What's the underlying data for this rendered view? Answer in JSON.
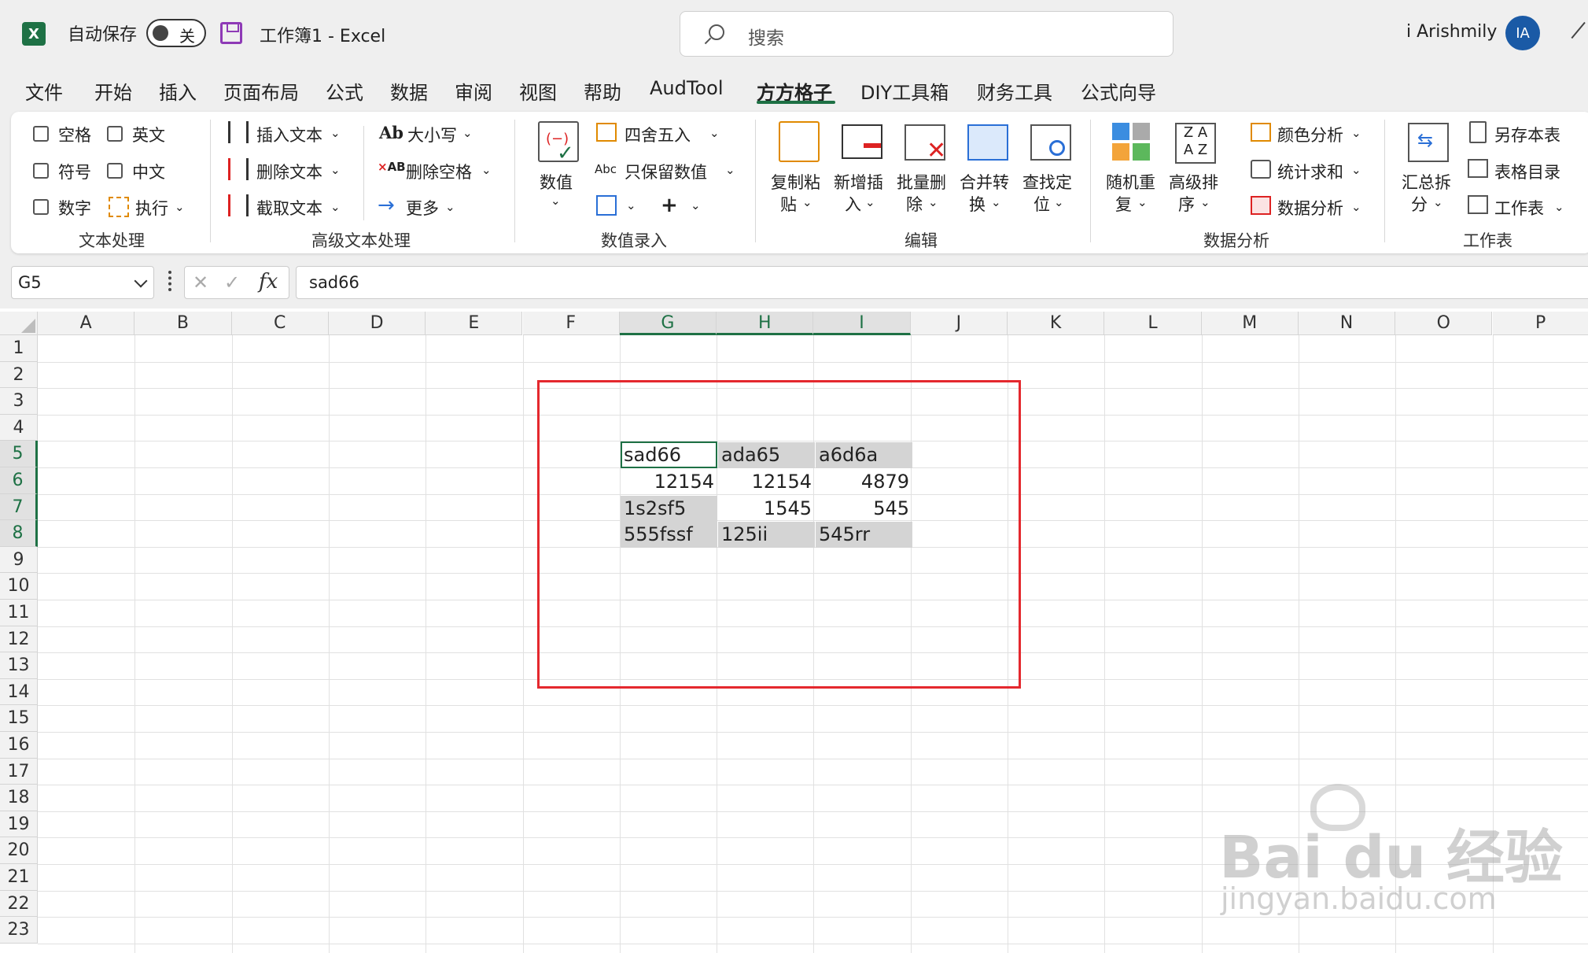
{
  "titlebar": {
    "autosave": "自动保存",
    "toggle_state": "关",
    "doc_title": "工作簿1  -  Excel",
    "search_placeholder": "搜索",
    "user_name": "i Arishmily",
    "avatar": "IA"
  },
  "menu": [
    "文件",
    "开始",
    "插入",
    "页面布局",
    "公式",
    "数据",
    "审阅",
    "视图",
    "帮助",
    "AudTool",
    "方方格子",
    "DIY工具箱",
    "财务工具",
    "公式向导"
  ],
  "ribbon": {
    "text_group": {
      "name": "文本处理",
      "checks": [
        "空格",
        "英文",
        "符号",
        "中文",
        "数字"
      ],
      "run": "执行"
    },
    "adv_text": {
      "name": "高级文本处理",
      "insert": "插入文本",
      "delete": "删除文本",
      "cut": "截取文本",
      "case": "大小写",
      "del_space": "删除空格",
      "more": "更多"
    },
    "num_entry": {
      "name": "数值录入",
      "value": "数值",
      "round": "四舍五入",
      "keep_num": "只保留数值"
    },
    "edit": {
      "name": "编辑",
      "copy_paste": [
        "复制粘",
        "贴"
      ],
      "add_insert": [
        "新增插",
        "入"
      ],
      "batch_del": [
        "批量删",
        "除"
      ],
      "merge": [
        "合并转",
        "换"
      ],
      "find": [
        "查找定",
        "位"
      ]
    },
    "analysis": {
      "name": "数据分析",
      "random": [
        "随机重",
        "复"
      ],
      "sort": [
        "高级排",
        "序"
      ],
      "color": "颜色分析",
      "stat": "统计求和",
      "data": "数据分析"
    },
    "sheet": {
      "name": "工作表",
      "summary": [
        "汇总拆",
        "分"
      ],
      "save_as": "另存本表",
      "toc": "表格目录",
      "sheet": "工作表"
    }
  },
  "formula_bar": {
    "name_box": "G5",
    "formula": "sad66"
  },
  "columns": [
    "A",
    "B",
    "C",
    "D",
    "E",
    "F",
    "G",
    "H",
    "I",
    "J",
    "K",
    "L",
    "M",
    "N",
    "O",
    "P"
  ],
  "rows": [
    "1",
    "2",
    "3",
    "4",
    "5",
    "6",
    "7",
    "8",
    "9",
    "10",
    "11",
    "12",
    "13",
    "14",
    "15",
    "16",
    "17",
    "18",
    "19",
    "20",
    "21",
    "22",
    "23"
  ],
  "cells": [
    [
      "sad66",
      "ada65",
      "a6d6a"
    ],
    [
      "12154",
      "12154",
      "4879"
    ],
    [
      "1s2sf5",
      "1545",
      "545"
    ],
    [
      "555fssf",
      "125ii",
      "545rr"
    ]
  ],
  "watermark": {
    "logo": "Bai du 经验",
    "url": "jingyan.baidu.com"
  },
  "colors": {
    "excel_green": "#1e7145",
    "highlight_gray": "#d4d4d4",
    "annotation_red": "#e4282e"
  }
}
